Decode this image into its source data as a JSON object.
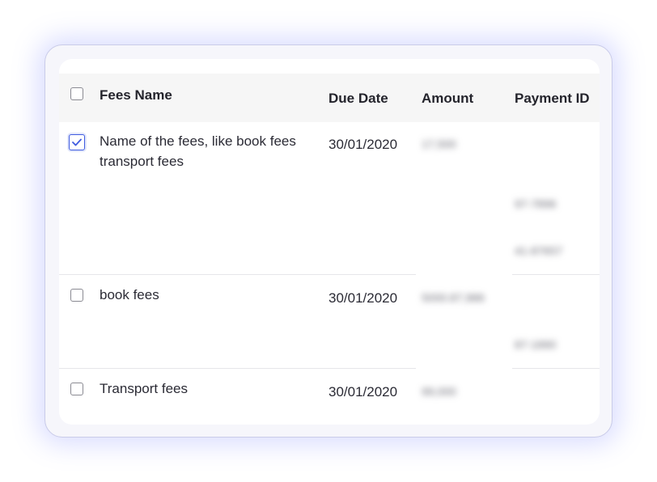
{
  "table": {
    "columns": {
      "fees_name": "Fees Name",
      "due_date": "Due Date",
      "amount": "Amount",
      "payment_id": "Payment ID"
    },
    "rows": [
      {
        "fees_name_line1": "Name of the fees, like book fees",
        "fees_name_line2": "transport fees",
        "due_date": "30/01/2020",
        "checked": true,
        "amount": "17,500",
        "payment_ids": [
          "97-7896",
          "41-87657"
        ]
      },
      {
        "fees_name_line1": "book fees",
        "due_date": "30/01/2020",
        "checked": false,
        "amount": "5000.87,986",
        "payment_ids": [
          "87-1890"
        ]
      },
      {
        "fees_name_line1": "Transport fees",
        "due_date": "30/01/2020",
        "checked": false,
        "amount": "99,000",
        "payment_ids": []
      }
    ]
  },
  "colors": {
    "accent": "#3f5be0",
    "card_border": "#c9cbe8",
    "header_bg": "#f6f6f6"
  }
}
